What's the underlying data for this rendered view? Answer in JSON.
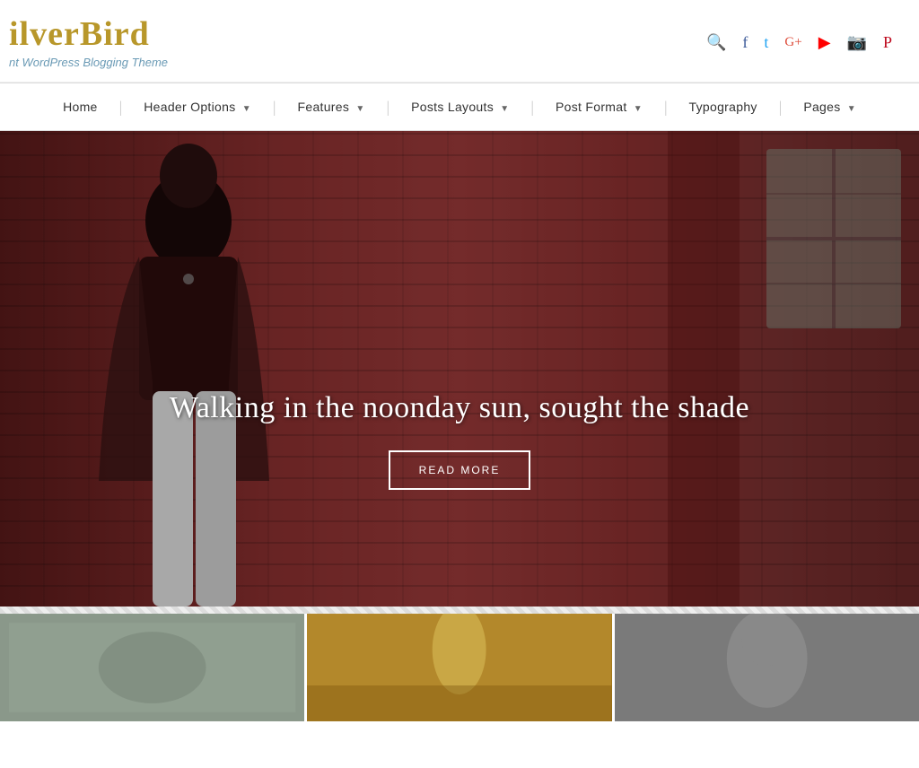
{
  "site": {
    "title": "ilverBird",
    "tagline": "nt WordPress Blogging Theme"
  },
  "header": {
    "icons": [
      {
        "name": "search-icon",
        "symbol": "🔍",
        "class": "search"
      },
      {
        "name": "facebook-icon",
        "symbol": "f",
        "class": "fb"
      },
      {
        "name": "twitter-icon",
        "symbol": "𝕥",
        "class": "tw"
      },
      {
        "name": "google-plus-icon",
        "symbol": "g+",
        "class": "gp"
      },
      {
        "name": "youtube-icon",
        "symbol": "▶",
        "class": "yt"
      },
      {
        "name": "instagram-icon",
        "symbol": "◻",
        "class": "ig"
      },
      {
        "name": "pinterest-icon",
        "symbol": "𝕡",
        "class": "pi"
      }
    ]
  },
  "nav": {
    "items": [
      {
        "label": "Home",
        "has_dropdown": false
      },
      {
        "label": "Header Options",
        "has_dropdown": true
      },
      {
        "label": "Features",
        "has_dropdown": true
      },
      {
        "label": "Posts Layouts",
        "has_dropdown": true
      },
      {
        "label": "Post Format",
        "has_dropdown": true
      },
      {
        "label": "Typography",
        "has_dropdown": false
      },
      {
        "label": "Pages",
        "has_dropdown": true
      }
    ]
  },
  "hero": {
    "title": "Walking in the noonday sun, sought the shade",
    "button_label": "READ MORE"
  },
  "thumbnails": [
    {
      "alt": "thumbnail 1"
    },
    {
      "alt": "thumbnail 2"
    },
    {
      "alt": "thumbnail 3"
    }
  ]
}
